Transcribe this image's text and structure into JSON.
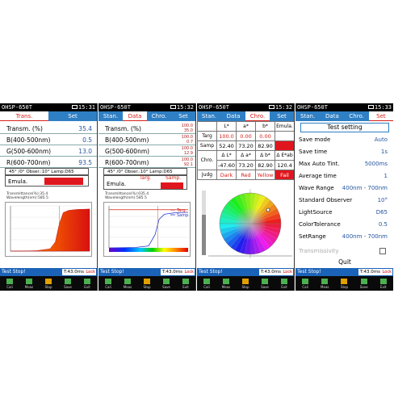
{
  "device": "OHSP-650T",
  "screens": [
    {
      "time": "15:31",
      "tabs": [
        {
          "label": "Trans."
        },
        {
          "label": "Set"
        }
      ],
      "rows": [
        {
          "label": "Transm. (%)",
          "value": "35.4"
        },
        {
          "label": "B(400-500nm)",
          "value": "0.5"
        },
        {
          "label": "G(500-600nm)",
          "value": "13.0"
        },
        {
          "label": "R(600-700nm)",
          "value": "93.5"
        }
      ],
      "observer": "45° /0° Obser.:10°  Lamp:D65",
      "emula": "Emula.",
      "plot_info": [
        "Transmittance(%):35.4",
        "Wavelength(nm):585.5"
      ],
      "status": "Test Stop!",
      "timer": "T:43.0ms",
      "lock": "Lock"
    },
    {
      "time": "15:32",
      "tabs": [
        {
          "label": "Stan."
        },
        {
          "label": "Data"
        },
        {
          "label": "Chro."
        },
        {
          "label": "Set"
        }
      ],
      "rows": [
        {
          "label": "Transm. (%)",
          "values": [
            "100.0",
            "35.0"
          ]
        },
        {
          "label": "B(400-500nm)",
          "values": [
            "100.0",
            "0.7"
          ]
        },
        {
          "label": "G(500-600nm)",
          "values": [
            "100.0",
            "12.9"
          ]
        },
        {
          "label": "R(600-700nm)",
          "values": [
            "100.0",
            "92.1"
          ]
        }
      ],
      "observer": "45° /0° Obser.:10°  Lamp:D65",
      "targ": "Targ.",
      "samp": "Samp.",
      "emula": "Emula.",
      "plot_info": [
        "Transmittance(%):035.4",
        "Wavelength(nm):585.5"
      ],
      "legend": [
        "Targ.",
        "Samp."
      ],
      "status": "Test Stop!",
      "timer": "T:43.0ms",
      "lock": "Lock"
    },
    {
      "time": "15:32",
      "tabs": [
        {
          "label": "Stan."
        },
        {
          "label": "Data"
        },
        {
          "label": "Chro."
        },
        {
          "label": "Set"
        }
      ],
      "grid": {
        "header": [
          "",
          "L*",
          "a*",
          "b*",
          "Emula."
        ],
        "targ": [
          "Targ",
          "100.0",
          "0.00",
          "0.00"
        ],
        "samp": [
          "Samp",
          "52.40",
          "73.20",
          "82.90"
        ],
        "chro_head": [
          "Chro.",
          "Δ L*",
          "Δ a*",
          "Δ b*",
          "Δ E*ab"
        ],
        "chro_vals": [
          "-47.60",
          "73.20",
          "82.90",
          "120.4"
        ],
        "judg": [
          "Judg",
          "Dark",
          "Red",
          "Yellow",
          "Fail"
        ]
      },
      "status": "Test Stop!",
      "timer": "T:43.0ms",
      "lock": "Lock"
    },
    {
      "time": "15:33",
      "tabs": [
        {
          "label": "Stan."
        },
        {
          "label": "Data"
        },
        {
          "label": "Chro."
        },
        {
          "label": "Set"
        }
      ],
      "title": "Test setting",
      "settings": [
        {
          "label": "Save mode",
          "value": "Auto"
        },
        {
          "label": "Save time",
          "value": "1s"
        },
        {
          "label": "Max Auto Tint.",
          "value": "5000ms"
        },
        {
          "label": "Average time",
          "value": "1"
        },
        {
          "label": "Wave Range",
          "value": "400nm - 700nm"
        },
        {
          "label": "Standard Observer",
          "value": "10°"
        },
        {
          "label": "LightSource",
          "value": "D65"
        },
        {
          "label": "ColorTolerance",
          "value": "0.5"
        },
        {
          "label": "SetRange",
          "value": "400nm - 700nm"
        }
      ],
      "transmissivity": "Transmissivity",
      "quit": "Quit",
      "status": "Test Stop!",
      "timer": "T:43.0ms",
      "lock": "Lock"
    }
  ],
  "buttons": [
    "Cali",
    "Meas",
    "Stop",
    "Save",
    "Exit"
  ],
  "colors": {
    "tab_bar": "#2f7fc4",
    "status_bar": "#1b63b8",
    "accent_red": "#e0161e",
    "value_blue": "#2455a0"
  },
  "chart_data": [
    {
      "type": "area",
      "x": [
        400,
        450,
        500,
        550,
        570,
        585,
        600,
        620,
        650,
        700
      ],
      "values": [
        0,
        0,
        1,
        5,
        20,
        60,
        85,
        90,
        92,
        93
      ],
      "xlim": [
        400,
        700
      ],
      "ylim": [
        0,
        100
      ]
    },
    {
      "type": "line",
      "series": [
        {
          "name": "Targ.",
          "x": [
            400,
            700
          ],
          "values": [
            100,
            100
          ]
        },
        {
          "name": "Samp.",
          "x": [
            400,
            500,
            550,
            575,
            590,
            610,
            650,
            700
          ],
          "values": [
            0,
            1,
            5,
            35,
            75,
            88,
            92,
            93
          ]
        }
      ],
      "xlim": [
        400,
        700
      ],
      "ylim": [
        0,
        110
      ]
    }
  ]
}
